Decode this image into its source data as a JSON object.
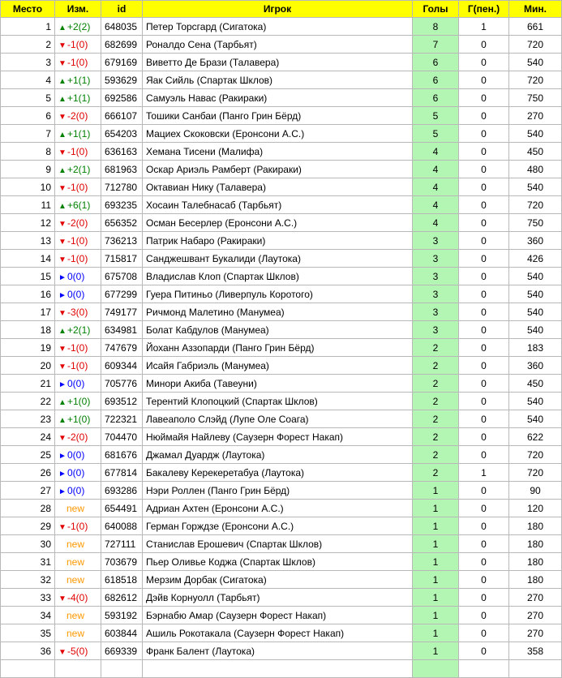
{
  "headers": {
    "place": "Место",
    "change": "Изм.",
    "id": "id",
    "player": "Игрок",
    "goals": "Голы",
    "penalties": "Г(пен.)",
    "minutes": "Мин."
  },
  "rows": [
    {
      "place": "1",
      "dir": "up",
      "arrow": "▲",
      "change": "+2(2)",
      "id": "648035",
      "player": "Петер Торсгард (Сигатока)",
      "goals": "8",
      "pen": "1",
      "mins": "661"
    },
    {
      "place": "2",
      "dir": "down",
      "arrow": "▼",
      "change": "-1(0)",
      "id": "682699",
      "player": "Роналдо Сена (Тарбьят)",
      "goals": "7",
      "pen": "0",
      "mins": "720"
    },
    {
      "place": "3",
      "dir": "down",
      "arrow": "▼",
      "change": "-1(0)",
      "id": "679169",
      "player": "Виветто Де Брази (Талавера)",
      "goals": "6",
      "pen": "0",
      "mins": "540"
    },
    {
      "place": "4",
      "dir": "up",
      "arrow": "▲",
      "change": "+1(1)",
      "id": "593629",
      "player": "Яак Сийль (Спартак Шклов)",
      "goals": "6",
      "pen": "0",
      "mins": "720"
    },
    {
      "place": "5",
      "dir": "up",
      "arrow": "▲",
      "change": "+1(1)",
      "id": "692586",
      "player": "Самуэль Навас (Ракираки)",
      "goals": "6",
      "pen": "0",
      "mins": "750"
    },
    {
      "place": "6",
      "dir": "down",
      "arrow": "▼",
      "change": "-2(0)",
      "id": "666107",
      "player": "Тошики Санбаи (Панго Грин Бёрд)",
      "goals": "5",
      "pen": "0",
      "mins": "270"
    },
    {
      "place": "7",
      "dir": "up",
      "arrow": "▲",
      "change": "+1(1)",
      "id": "654203",
      "player": "Мациех Скоковски (Еронсони А.С.)",
      "goals": "5",
      "pen": "0",
      "mins": "540"
    },
    {
      "place": "8",
      "dir": "down",
      "arrow": "▼",
      "change": "-1(0)",
      "id": "636163",
      "player": "Хемана Тисени (Малифа)",
      "goals": "4",
      "pen": "0",
      "mins": "450"
    },
    {
      "place": "9",
      "dir": "up",
      "arrow": "▲",
      "change": "+2(1)",
      "id": "681963",
      "player": "Оскар Ариэль Рамберт (Ракираки)",
      "goals": "4",
      "pen": "0",
      "mins": "480"
    },
    {
      "place": "10",
      "dir": "down",
      "arrow": "▼",
      "change": "-1(0)",
      "id": "712780",
      "player": "Октавиан Нику (Талавера)",
      "goals": "4",
      "pen": "0",
      "mins": "540"
    },
    {
      "place": "11",
      "dir": "up",
      "arrow": "▲",
      "change": "+6(1)",
      "id": "693235",
      "player": "Хосаин Талебнасаб (Тарбьят)",
      "goals": "4",
      "pen": "0",
      "mins": "720"
    },
    {
      "place": "12",
      "dir": "down",
      "arrow": "▼",
      "change": "-2(0)",
      "id": "656352",
      "player": "Осман Бесерлер (Еронсони А.С.)",
      "goals": "4",
      "pen": "0",
      "mins": "750"
    },
    {
      "place": "13",
      "dir": "down",
      "arrow": "▼",
      "change": "-1(0)",
      "id": "736213",
      "player": "Патрик Набаро (Ракираки)",
      "goals": "3",
      "pen": "0",
      "mins": "360"
    },
    {
      "place": "14",
      "dir": "down",
      "arrow": "▼",
      "change": "-1(0)",
      "id": "715817",
      "player": "Санджешвант Букалиди (Лаутока)",
      "goals": "3",
      "pen": "0",
      "mins": "426"
    },
    {
      "place": "15",
      "dir": "same",
      "arrow": "►",
      "change": "0(0)",
      "id": "675708",
      "player": "Владислав Клоп (Спартак Шклов)",
      "goals": "3",
      "pen": "0",
      "mins": "540"
    },
    {
      "place": "16",
      "dir": "same",
      "arrow": "►",
      "change": "0(0)",
      "id": "677299",
      "player": "Гуера Питиньо (Ливерпуль Коротого)",
      "goals": "3",
      "pen": "0",
      "mins": "540"
    },
    {
      "place": "17",
      "dir": "down",
      "arrow": "▼",
      "change": "-3(0)",
      "id": "749177",
      "player": "Ричмонд Малетино (Манумеа)",
      "goals": "3",
      "pen": "0",
      "mins": "540"
    },
    {
      "place": "18",
      "dir": "up",
      "arrow": "▲",
      "change": "+2(1)",
      "id": "634981",
      "player": "Болат Кабдулов (Манумеа)",
      "goals": "3",
      "pen": "0",
      "mins": "540"
    },
    {
      "place": "19",
      "dir": "down",
      "arrow": "▼",
      "change": "-1(0)",
      "id": "747679",
      "player": "Йоханн Аззопарди (Панго Грин Бёрд)",
      "goals": "2",
      "pen": "0",
      "mins": "183"
    },
    {
      "place": "20",
      "dir": "down",
      "arrow": "▼",
      "change": "-1(0)",
      "id": "609344",
      "player": "Исайя Габриэль (Манумеа)",
      "goals": "2",
      "pen": "0",
      "mins": "360"
    },
    {
      "place": "21",
      "dir": "same",
      "arrow": "►",
      "change": "0(0)",
      "id": "705776",
      "player": "Минори Акиба (Тавеуни)",
      "goals": "2",
      "pen": "0",
      "mins": "450"
    },
    {
      "place": "22",
      "dir": "up",
      "arrow": "▲",
      "change": "+1(0)",
      "id": "693512",
      "player": "Терентий Клопоцкий (Спартак Шклов)",
      "goals": "2",
      "pen": "0",
      "mins": "540"
    },
    {
      "place": "23",
      "dir": "up",
      "arrow": "▲",
      "change": "+1(0)",
      "id": "722321",
      "player": "Лавеаполо Слэйд (Лупе Оле Соага)",
      "goals": "2",
      "pen": "0",
      "mins": "540"
    },
    {
      "place": "24",
      "dir": "down",
      "arrow": "▼",
      "change": "-2(0)",
      "id": "704470",
      "player": "Нюймайя Найлеву (Саузерн Форест Накап)",
      "goals": "2",
      "pen": "0",
      "mins": "622"
    },
    {
      "place": "25",
      "dir": "same",
      "arrow": "►",
      "change": "0(0)",
      "id": "681676",
      "player": "Джамал Дуардж (Лаутока)",
      "goals": "2",
      "pen": "0",
      "mins": "720"
    },
    {
      "place": "26",
      "dir": "same",
      "arrow": "►",
      "change": "0(0)",
      "id": "677814",
      "player": "Бакалеву Керекеретабуа (Лаутока)",
      "goals": "2",
      "pen": "1",
      "mins": "720"
    },
    {
      "place": "27",
      "dir": "same",
      "arrow": "►",
      "change": "0(0)",
      "id": "693286",
      "player": "Нэри Роллен (Панго Грин Бёрд)",
      "goals": "1",
      "pen": "0",
      "mins": "90"
    },
    {
      "place": "28",
      "dir": "new",
      "arrow": "",
      "change": "new",
      "id": "654491",
      "player": "Адриан Ахтен (Еронсони А.С.)",
      "goals": "1",
      "pen": "0",
      "mins": "120"
    },
    {
      "place": "29",
      "dir": "down",
      "arrow": "▼",
      "change": "-1(0)",
      "id": "640088",
      "player": "Герман Горждзе (Еронсони А.С.)",
      "goals": "1",
      "pen": "0",
      "mins": "180"
    },
    {
      "place": "30",
      "dir": "new",
      "arrow": "",
      "change": "new",
      "id": "727111",
      "player": "Станислав Ерошевич (Спартак Шклов)",
      "goals": "1",
      "pen": "0",
      "mins": "180"
    },
    {
      "place": "31",
      "dir": "new",
      "arrow": "",
      "change": "new",
      "id": "703679",
      "player": "Пьер Оливье Коджа (Спартак Шклов)",
      "goals": "1",
      "pen": "0",
      "mins": "180"
    },
    {
      "place": "32",
      "dir": "new",
      "arrow": "",
      "change": "new",
      "id": "618518",
      "player": "Мерзим Дорбак (Сигатока)",
      "goals": "1",
      "pen": "0",
      "mins": "180"
    },
    {
      "place": "33",
      "dir": "down",
      "arrow": "▼",
      "change": "-4(0)",
      "id": "682612",
      "player": "Дэйв Корнуолл (Тарбьят)",
      "goals": "1",
      "pen": "0",
      "mins": "270"
    },
    {
      "place": "34",
      "dir": "new",
      "arrow": "",
      "change": "new",
      "id": "593192",
      "player": "Бэрнабю Амар (Саузерн Форест Накап)",
      "goals": "1",
      "pen": "0",
      "mins": "270"
    },
    {
      "place": "35",
      "dir": "new",
      "arrow": "",
      "change": "new",
      "id": "603844",
      "player": "Ашиль Рокотакала (Саузерн Форест Накап)",
      "goals": "1",
      "pen": "0",
      "mins": "270"
    },
    {
      "place": "36",
      "dir": "down",
      "arrow": "▼",
      "change": "-5(0)",
      "id": "669339",
      "player": "Франк Балент (Лаутока)",
      "goals": "1",
      "pen": "0",
      "mins": "358"
    },
    {
      "place": "",
      "dir": "",
      "arrow": "",
      "change": "",
      "id": "",
      "player": "",
      "goals": "",
      "pen": "",
      "mins": ""
    }
  ],
  "colors": {
    "header_bg": "#ffff00",
    "goals_bg": "#b3f5b3",
    "up": "#008000",
    "down": "#e00000",
    "same": "#0000ff",
    "new": "#ff9900"
  }
}
